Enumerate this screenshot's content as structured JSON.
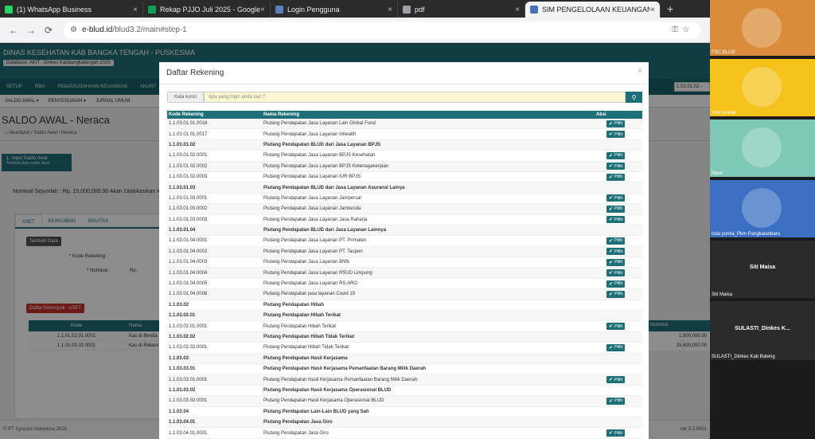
{
  "browser": {
    "tabs": [
      {
        "label": "(1) WhatsApp Business",
        "color": "#25d366",
        "active": false
      },
      {
        "label": "Rekap PJJO Juli 2025 - Google S",
        "color": "#0f9d58",
        "active": false
      },
      {
        "label": "Login Pengguna",
        "color": "#5b7fbd",
        "active": false
      },
      {
        "label": "pdf",
        "color": "#9aa0a6",
        "active": false
      },
      {
        "label": "SIM PENGELOLAAN KEUANGAN",
        "color": "#4a6fb5",
        "active": true
      }
    ],
    "url_domain": "e-blud.id",
    "url_path": "/blud3.2/main#step-1"
  },
  "page": {
    "header_text": "DINAS KESEHATAN KAB BANGKA TENGAH - PUSKESMA",
    "db_label": "Database: AKIT : Dinkes Kabbangkatengah 2025",
    "menu": [
      "SETUP",
      "RBA",
      "PENATAUSAHAAN KEUANGAN",
      "AKUNT"
    ],
    "submenu": [
      "SALDO AWAL ▾",
      "PENYESUAIAN ▾",
      "JURNAL UMUM"
    ],
    "title": "SALDO AWAL - Neraca",
    "breadcrumb": "Akuntansi / Saldo Awal / Neraca",
    "step_label": "1. Input Saldo Awal",
    "step_sub": "Tambah data saldo awal",
    "nominal": "Nominal Sejumlah : Rp. 15,000,000.00 Akan Dialokasikan ke A",
    "panel_tabs": [
      "ASET",
      "KEWAJIBAN",
      "EKUITAS"
    ],
    "tambah_data": "Tambah Data",
    "kode_rekening_label": "* Kode Rekening :",
    "nominal_label": "* Nominal :",
    "rp": "Rp.",
    "daftar_kelompok": "Daftar Kelompok : ASET",
    "table_headers": [
      "Kode",
      "Nama"
    ],
    "table_rows": [
      [
        "1.1.01.02.01.0001",
        "Kas di Benda"
      ],
      [
        "1.1.01.02.02.0001",
        "Kas di Rekeni"
      ]
    ],
    "nominal_header": "Nominal",
    "nominal_values": [
      "1,000,000.00",
      "15,600,000.00"
    ],
    "kode_top": "1.02.01.02 -",
    "footer_left": "© PT Syncore Indonesia 2025",
    "footer_right": "ver 3.2.0001"
  },
  "modal": {
    "title": "Daftar Rekening",
    "search_label": "Kata kunci",
    "search_placeholder": "Apa yang ingin anda cari ?",
    "columns": [
      "Kode Rekening",
      "Nama Rekening",
      "Aksi"
    ],
    "pilih_label": "Pilih",
    "rows": [
      {
        "kode": "1.1.03.01.01.0016",
        "nama": "Piutang Pendapatan Jasa Layanan Lain Global Fund",
        "group": false
      },
      {
        "kode": "1.1.03.01.01.0017",
        "nama": "Piutang Pendapatan Jasa Layanan Inhealth",
        "group": false
      },
      {
        "kode": "1.1.03.01.02",
        "nama": "Piutang Pendapatan BLUD dari Jasa Layanan BPJS",
        "group": true
      },
      {
        "kode": "1.1.03.01.02.0001",
        "nama": "Piutang Pendapatan Jasa Layanan BPJS Kesehatan",
        "group": false
      },
      {
        "kode": "1.1.03.01.02.0002",
        "nama": "Piutang Pendapatan Jasa Layanan BPJS Ketenagakerjaan",
        "group": false
      },
      {
        "kode": "1.1.03.01.02.0003",
        "nama": "Piutang Pendapatan Jasa Layanan IUR BPJS",
        "group": false
      },
      {
        "kode": "1.1.03.01.03",
        "nama": "Piutang Pendapatan BLUD dari Jasa Layanan Asuransi Lainya",
        "group": true
      },
      {
        "kode": "1.1.03.01.03.0001",
        "nama": "Piutang Pendapatan Jasa Layanan Jampersal",
        "group": false
      },
      {
        "kode": "1.1.03.01.03.0002",
        "nama": "Piutang Pendapatan Jasa Layanan Jamkesda",
        "group": false
      },
      {
        "kode": "1.1.03.01.03.0003",
        "nama": "Piutang Pendapatan Jasa Layanan Jasa Raharja",
        "group": false
      },
      {
        "kode": "1.1.03.01.04",
        "nama": "Piutang Pendapatan BLUD dari Jasa Layanan Lainnya",
        "group": true
      },
      {
        "kode": "1.1.03.01.04.0001",
        "nama": "Piutang Pendapatan Jasa Layanan PT. Primatex",
        "group": false
      },
      {
        "kode": "1.1.03.01.04.0002",
        "nama": "Piutang Pendapatan Jasa Layanan PT. Taspen",
        "group": false
      },
      {
        "kode": "1.1.03.01.04.0003",
        "nama": "Piutang Pendapatan Jasa Layanan BNN",
        "group": false
      },
      {
        "kode": "1.1.03.01.04.0004",
        "nama": "Piutang Pendapatan Jasa Layanan RSUD Limpung",
        "group": false
      },
      {
        "kode": "1.1.03.01.04.0005",
        "nama": "Piutang Pendapatan Jasa Layanan RS.ARO",
        "group": false
      },
      {
        "kode": "1.1.03.01.04.0006",
        "nama": "Piutang Pendapatan jasa layanan Covid 19",
        "group": false
      },
      {
        "kode": "1.1.03.02",
        "nama": "Piutang Pendapatan Hibah",
        "group": true
      },
      {
        "kode": "1.1.03.02.01",
        "nama": "Piutang Pendapatan Hibah Terikat",
        "group": true
      },
      {
        "kode": "1.1.03.02.01.0001",
        "nama": "Piutang Pendapatan Hibah Terikat",
        "group": false
      },
      {
        "kode": "1.1.03.02.02",
        "nama": "Piutang Pendapatan Hibah Tidak Terikat",
        "group": true
      },
      {
        "kode": "1.1.03.02.02.0001",
        "nama": "Piutang Pendapatan Hibah Tidak Terikat",
        "group": false
      },
      {
        "kode": "1.1.03.03",
        "nama": "Piutang Pendapatan Hasil Kerjasama",
        "group": true
      },
      {
        "kode": "1.1.03.03.01",
        "nama": "Piutang Pendapatan Hasil Kerjasama Pemanfaatan Barang Milik Daerah",
        "group": true
      },
      {
        "kode": "1.1.03.03.01.0001",
        "nama": "Piutang Pendapatan Hasil Kerjasama Pemanfaatan Barang Milik Daerah",
        "group": false
      },
      {
        "kode": "1.1.03.03.02",
        "nama": "Piutang Pendapatan Hasil Kerjasama Operasional BLUD",
        "group": true
      },
      {
        "kode": "1.1.03.03.02.0001",
        "nama": "Piutang Pendapatan Hasil Kerjasama Operasional BLUD",
        "group": false
      },
      {
        "kode": "1.1.03.04",
        "nama": "Piutang Pendapatan Lain-Lain BLUD yang Sah",
        "group": true
      },
      {
        "kode": "1.1.03.04.01",
        "nama": "Piutang Pendapatan Jasa Giro",
        "group": true
      },
      {
        "kode": "1.1.03.04.01.0001",
        "nama": "Piutang Pendapatan Jasa Giro",
        "group": false
      }
    ]
  },
  "participants": [
    {
      "name": "FSC BLUD",
      "kind": "image",
      "bg": "#d98c3a"
    },
    {
      "name": "Yuni pratiwi",
      "kind": "image",
      "bg": "#f5c21b"
    },
    {
      "name": "Nken",
      "kind": "image",
      "bg": "#7ec9b5"
    },
    {
      "name": "Istia yunita_Pkm Pangkalanbaru",
      "kind": "image",
      "bg": "#3a6fc2"
    },
    {
      "name": "Siti Maisa",
      "kind": "name",
      "bg": "#2b2b2b"
    },
    {
      "name": "SULASTI_Dinkes Kab Bateng",
      "kind": "name",
      "center": "SULASTI_Dinkes  K...",
      "bg": "#2b2b2b"
    }
  ]
}
